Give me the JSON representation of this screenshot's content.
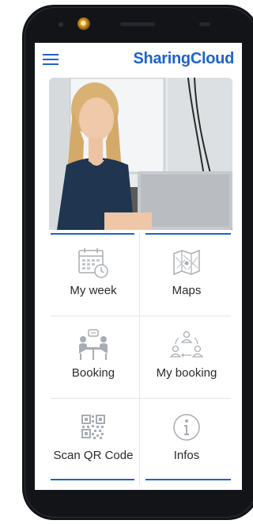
{
  "app": {
    "brand": "SharingCloud"
  },
  "tiles": [
    {
      "label": "My week",
      "icon": "calendar-clock-icon"
    },
    {
      "label": "Maps",
      "icon": "map-icon"
    },
    {
      "label": "Booking",
      "icon": "meeting-icon"
    },
    {
      "label": "My booking",
      "icon": "people-cycle-icon"
    },
    {
      "label": "Scan QR Code",
      "icon": "qr-code-icon"
    },
    {
      "label": "Infos",
      "icon": "info-icon"
    }
  ],
  "colors": {
    "accent": "#1e64c8",
    "icon_gray": "#a8adb3",
    "phone": "#121417"
  }
}
